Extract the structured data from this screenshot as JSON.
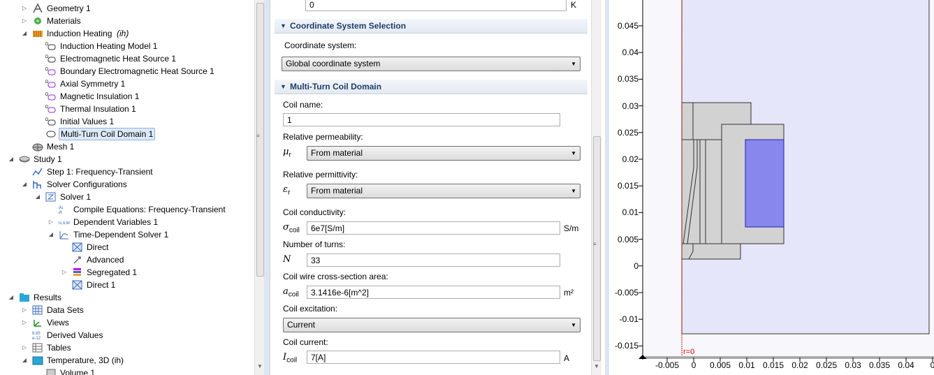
{
  "tree": {
    "items": [
      {
        "label": "Geometry 1",
        "icon": "geometry-icon",
        "exp": "▷"
      },
      {
        "label": "Materials",
        "icon": "materials-icon",
        "exp": "▷"
      },
      {
        "label": "Induction Heating",
        "tag": "(ih)",
        "icon": "physics-icon",
        "exp": "◢"
      },
      {
        "label": "Induction Heating Model 1",
        "icon": "domain-feature-icon",
        "exp": ""
      },
      {
        "label": "Electromagnetic Heat Source 1",
        "icon": "domain-feature-icon",
        "exp": ""
      },
      {
        "label": "Boundary Electromagnetic Heat Source 1",
        "icon": "boundary-feature-icon",
        "exp": ""
      },
      {
        "label": "Axial Symmetry 1",
        "icon": "boundary-feature-icon",
        "exp": ""
      },
      {
        "label": "Magnetic Insulation 1",
        "icon": "boundary-feature-icon",
        "exp": ""
      },
      {
        "label": "Thermal Insulation 1",
        "icon": "boundary-feature-icon",
        "exp": ""
      },
      {
        "label": "Initial Values 1",
        "icon": "domain-feature-icon",
        "exp": ""
      },
      {
        "label": "Multi-Turn Coil Domain 1",
        "icon": "coil-domain-icon",
        "exp": ""
      },
      {
        "label": "Mesh 1",
        "icon": "mesh-icon",
        "exp": ""
      },
      {
        "label": "Study 1",
        "icon": "study-icon",
        "exp": "◢"
      },
      {
        "label": "Step 1: Frequency-Transient",
        "icon": "study-step-icon",
        "exp": ""
      },
      {
        "label": "Solver Configurations",
        "icon": "solver-configurations-icon",
        "exp": "◢"
      },
      {
        "label": "Solver 1",
        "icon": "solver-icon",
        "exp": "◢"
      },
      {
        "label": "Compile Equations: Frequency-Transient",
        "icon": "compile-equations-icon",
        "exp": ""
      },
      {
        "label": "Dependent Variables 1",
        "icon": "dependent-variables-icon",
        "exp": "▷"
      },
      {
        "label": "Time-Dependent Solver 1",
        "icon": "time-dependent-solver-icon",
        "exp": "◢"
      },
      {
        "label": "Direct",
        "icon": "direct-icon",
        "exp": ""
      },
      {
        "label": "Advanced",
        "icon": "advanced-icon",
        "exp": ""
      },
      {
        "label": "Segregated 1",
        "icon": "segregated-icon",
        "exp": "▷"
      },
      {
        "label": "Direct 1",
        "icon": "direct-icon",
        "exp": ""
      },
      {
        "label": "Results",
        "icon": "results-icon",
        "exp": "◢"
      },
      {
        "label": "Data Sets",
        "icon": "data-sets-icon",
        "exp": "▷"
      },
      {
        "label": "Views",
        "icon": "views-icon",
        "exp": "▷"
      },
      {
        "label": "Derived Values",
        "icon": "derived-values-icon",
        "exp": ""
      },
      {
        "label": "Tables",
        "icon": "tables-icon",
        "exp": "▷"
      },
      {
        "label": "Temperature, 3D (ih)",
        "icon": "plot-group-3d-icon",
        "exp": "◢"
      },
      {
        "label": "Volume 1",
        "icon": "volume-plot-icon",
        "exp": ""
      }
    ]
  },
  "settings": {
    "top_value": "0",
    "top_unit": "K",
    "coord_section": "Coordinate System Selection",
    "coord_label": "Coordinate system:",
    "coord_value": "Global coordinate system",
    "coil_section": "Multi-Turn Coil Domain",
    "coil_name_label": "Coil name:",
    "coil_name": "1",
    "mu_label": "Relative permeability:",
    "mu_sym": "μ",
    "mu_sub": "r",
    "mu_value": "From material",
    "eps_label": "Relative permittivity:",
    "eps_sym": "ε",
    "eps_sub": "r",
    "eps_value": "From material",
    "sigma_label": "Coil conductivity:",
    "sigma_sym": "σ",
    "sigma_sub": "coil",
    "sigma_value": "6e7[S/m]",
    "sigma_unit": "S/m",
    "turns_label": "Number of turns:",
    "turns_sym": "N",
    "turns_value": "33",
    "area_label": "Coil wire cross-section area:",
    "area_sym": "a",
    "area_sub": "coil",
    "area_value": "3.1416e-6[m^2]",
    "area_unit": "m²",
    "excitation_label": "Coil excitation:",
    "excitation_value": "Current",
    "current_label": "Coil current:",
    "current_sym": "I",
    "current_sub": "coil",
    "current_value": "7[A]",
    "current_unit": "A"
  },
  "graphics": {
    "y_ticks": [
      "0.045",
      "0.04",
      "0.035",
      "0.03",
      "0.025",
      "0.02",
      "0.015",
      "0.01",
      "0.005",
      "0",
      "-0.005",
      "-0.01",
      "-0.015"
    ],
    "x_ticks": [
      "-0.005",
      "0",
      "0.005",
      "0.01",
      "0.015",
      "0.02",
      "0.025",
      "0.03",
      "0.035",
      "0.04",
      "0"
    ],
    "axis_marker": "r=0",
    "colors": {
      "domain": "#e6e6fa",
      "part": "#d2d2d2",
      "coil": "#8787ee",
      "axis": "#cc0000"
    }
  }
}
